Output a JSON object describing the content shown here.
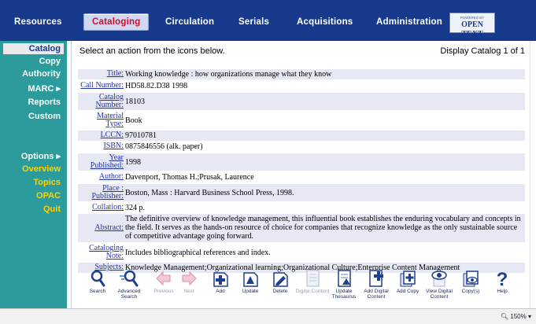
{
  "topnav": {
    "items": [
      {
        "label": "Resources"
      },
      {
        "label": "Cataloging",
        "active": true
      },
      {
        "label": "Circulation"
      },
      {
        "label": "Serials"
      },
      {
        "label": "Acquisitions"
      },
      {
        "label": "Administration"
      }
    ],
    "brand": {
      "powered_by": "POWERED BY",
      "name": "OPEN TEXT"
    }
  },
  "sidebar": {
    "items": [
      {
        "label": "Catalog",
        "active": true
      },
      {
        "label": "Copy"
      },
      {
        "label": "Authority"
      },
      {
        "label": "MARC ▸"
      },
      {
        "label": "Reports"
      },
      {
        "label": "Custom"
      },
      {
        "label": "Options ▸"
      },
      {
        "label": "Overview"
      },
      {
        "label": "Topics"
      },
      {
        "label": "OPAC"
      },
      {
        "label": "Quit"
      }
    ]
  },
  "main": {
    "instruction": "Select an action from the icons below.",
    "display_status": "Display Catalog  1 of 1"
  },
  "record": {
    "fields": [
      {
        "label": "Title:",
        "value": "Working knowledge : how organizations manage what they know"
      },
      {
        "label": "Call Number:",
        "value": "HD58.82.D38 1998"
      },
      {
        "label": "Catalog Number:",
        "value": "18103"
      },
      {
        "label": "Material Type:",
        "value": "Book"
      },
      {
        "label": "LCCN:",
        "value": "97010781"
      },
      {
        "label": "ISBN:",
        "value": "0875846556 (alk. paper)"
      },
      {
        "label": "Year Published:",
        "value": "1998"
      },
      {
        "label": "Author:",
        "value": "Davenport, Thomas H.;Prusak, Laurence"
      },
      {
        "label": "Place : Publisher:",
        "value": "Boston, Mass : Harvard Business School Press, 1998."
      },
      {
        "label": "Collation:",
        "value": "324 p."
      },
      {
        "label": "Abstract:",
        "value": "The definitive overview of knowledge management, this influential book establishes the enduring vocabulary and concepts in the field. It serves as the hands-on resource of choice for companies that recognize knowledge as the only sustainable source of competitive advantage going forward."
      },
      {
        "label": "Cataloging Note:",
        "value": "Includes bibliographical references and index."
      },
      {
        "label": "Subjects:",
        "value": "Knowledge Management;Organizational learning;Organizational Culture;Enterprise Content Management"
      }
    ]
  },
  "toolbar": {
    "search": "Search",
    "advanced_search": "Advanced Search",
    "previous": "Previous",
    "next": "Next",
    "add": "Add",
    "update": "Update",
    "delete": "Delete",
    "digital_content": "Digital Content",
    "update_thesaurus": "Update Thesaurus",
    "add_digital_content": "Add Digital Content",
    "add_copy": "Add Copy",
    "view_digital_content": "View Digital Content",
    "copys": "Copy(s)",
    "help": "Help"
  },
  "status": {
    "zoom": "150%"
  },
  "colors": {
    "nav_bg": "#173a8c",
    "sidebar_bg": "#2c9b9b",
    "active_text": "#c8102e",
    "highlight_text": "#ffd200",
    "field_shade": "#e6e8f4"
  }
}
